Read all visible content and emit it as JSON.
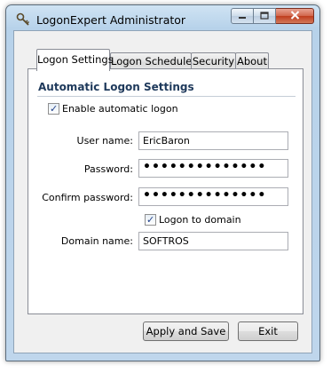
{
  "window": {
    "title": "LogonExpert Administrator"
  },
  "tabs": [
    {
      "label": "Logon Settings",
      "active": true
    },
    {
      "label": "Logon Scheduler",
      "active": false
    },
    {
      "label": "Security",
      "active": false
    },
    {
      "label": "About",
      "active": false
    }
  ],
  "panel": {
    "section_title": "Automatic Logon Settings",
    "enable_auto_logon": {
      "label": "Enable automatic logon",
      "checked": true
    },
    "user_name": {
      "label": "User name:",
      "value": "EricBaron"
    },
    "password": {
      "label": "Password:",
      "value": "••••••••••••••"
    },
    "confirm_password": {
      "label": "Confirm password:",
      "value": "••••••••••••••"
    },
    "logon_to_domain": {
      "label": "Logon to domain",
      "checked": true
    },
    "domain_name": {
      "label": "Domain name:",
      "value": "SOFTROS"
    }
  },
  "buttons": {
    "apply_save": "Apply and Save",
    "exit": "Exit"
  },
  "icons": {
    "app": "key-icon",
    "minimize": "minimize-icon",
    "maximize": "maximize-icon",
    "close": "close-icon",
    "check": "checkmark-icon"
  }
}
